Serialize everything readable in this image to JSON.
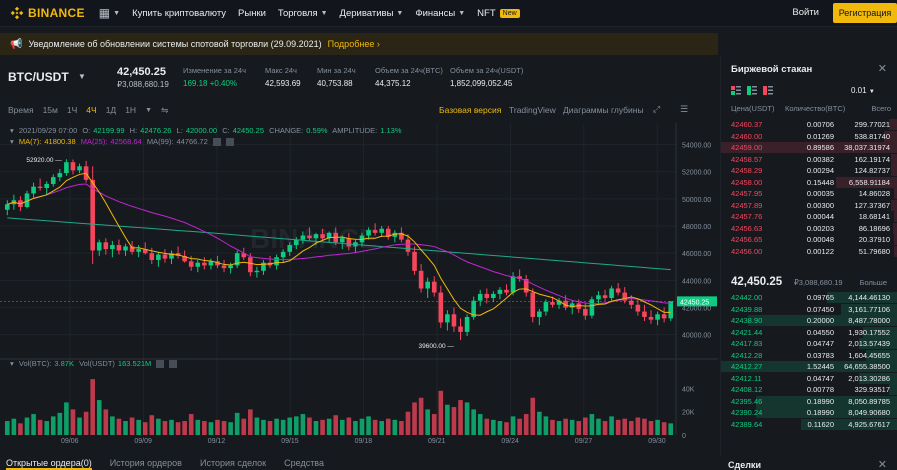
{
  "brand": {
    "name": "BINANCE",
    "color": "#f0b90b"
  },
  "nav": {
    "items": [
      {
        "label": "Купить криптовалюту",
        "dropdown": false
      },
      {
        "label": "Рынки",
        "dropdown": false
      },
      {
        "label": "Торговля",
        "dropdown": true
      },
      {
        "label": "Деривативы",
        "dropdown": true
      },
      {
        "label": "Финансы",
        "dropdown": true
      },
      {
        "label": "NFT",
        "dropdown": false,
        "badge": "New"
      }
    ],
    "login": "Войти",
    "register": "Регистрация"
  },
  "notice": {
    "text": "Уведомление об обновлении системы спотовой торговли (29.09.2021)",
    "more": "Подробнее"
  },
  "ticker": {
    "pair": "BTC/USDT",
    "last_price": "42,450.25",
    "last_price_usd": "₽3,088,680.19",
    "stats": [
      {
        "label": "Изменение за 24ч",
        "value": "169.18 +0.40%",
        "green": true
      },
      {
        "label": "Макс 24ч",
        "value": "42,593.69",
        "green": false
      },
      {
        "label": "Мин за 24ч",
        "value": "40,753.88",
        "green": false
      },
      {
        "label": "Объем за 24ч(BTC)",
        "value": "44,375.12",
        "green": false
      },
      {
        "label": "Объем за 24ч(USDT)",
        "value": "1,852,099,052.45",
        "green": false
      }
    ]
  },
  "toolbar": {
    "timeframes": [
      "Время",
      "15м",
      "1Ч",
      "4Ч",
      "1Д",
      "1Н"
    ],
    "active_timeframe": "4Ч",
    "views": [
      "Базовая версия",
      "TradingView",
      "Диаграммы глубины"
    ],
    "active_view": "Базовая версия"
  },
  "legend": {
    "ohlc": {
      "date": "2021/09/29 07:00",
      "o_label": "O:",
      "o": "42199.99",
      "h_label": "H:",
      "h": "42476.26",
      "l_label": "L:",
      "l": "42000.00",
      "c_label": "C:",
      "c": "42450.25",
      "change_label": "CHANGE:",
      "change": "0.59%",
      "amp_label": "AMPLITUDE:",
      "amp": "1.13%"
    },
    "ma": {
      "ma7_label": "MA(7):",
      "ma7": "41800.38",
      "ma25_label": "MA(25):",
      "ma25": "42568.64",
      "ma99_label": "MA(99):",
      "ma99": "44766.72"
    },
    "vol": {
      "btc_label": "Vol(BTC):",
      "btc": "3.87K",
      "usdt_label": "Vol(USDT)",
      "usdt": "163.521M"
    }
  },
  "colors": {
    "up": "#0ecb81",
    "down": "#f6465d",
    "ma7": "#f0b90b",
    "ma25": "#c026d3",
    "ma99": "#22a88a",
    "accent": "#f0b90b"
  },
  "chart_data": {
    "type": "candlestick",
    "x_ticks": [
      "09/06",
      "09/09",
      "09/12",
      "09/15",
      "09/18",
      "09/21",
      "09/24",
      "09/27",
      "09/30"
    ],
    "y_ticks": [
      "54000.00",
      "52000.00",
      "50000.00",
      "48000.00",
      "46000.00",
      "44000.00",
      "42000.00",
      "40000.00"
    ],
    "ylim": [
      38500,
      55000
    ],
    "vol_ticks": [
      "40K",
      "20K",
      "0"
    ],
    "annotations": {
      "high": "52920.00",
      "low": "39600.00"
    },
    "current_price": "42450.25",
    "candles": [
      [
        49200,
        49900,
        48800,
        49600
      ],
      [
        49600,
        50300,
        49200,
        49900
      ],
      [
        49900,
        50200,
        49100,
        49400
      ],
      [
        49400,
        50600,
        49300,
        50400
      ],
      [
        50400,
        51200,
        50100,
        50900
      ],
      [
        50900,
        51500,
        50600,
        50800
      ],
      [
        50800,
        51300,
        50300,
        51100
      ],
      [
        51100,
        51800,
        50900,
        51600
      ],
      [
        51600,
        52200,
        51300,
        51900
      ],
      [
        51900,
        52920,
        51700,
        52700
      ],
      [
        52700,
        52900,
        51800,
        52100
      ],
      [
        52100,
        52600,
        51900,
        52400
      ],
      [
        52400,
        52800,
        51200,
        51400
      ],
      [
        51400,
        52400,
        45200,
        46200
      ],
      [
        46200,
        47000,
        45800,
        46800
      ],
      [
        46800,
        47100,
        45900,
        46300
      ],
      [
        46300,
        46900,
        45700,
        46600
      ],
      [
        46600,
        47000,
        45900,
        46200
      ],
      [
        46200,
        46700,
        45800,
        46500
      ],
      [
        46500,
        46900,
        45900,
        46100
      ],
      [
        46100,
        46600,
        45700,
        46300
      ],
      [
        46300,
        46800,
        45900,
        46000
      ],
      [
        46000,
        46400,
        45200,
        45500
      ],
      [
        45500,
        46100,
        45000,
        45900
      ],
      [
        45900,
        46300,
        45300,
        45600
      ],
      [
        45600,
        46200,
        45200,
        46000
      ],
      [
        46000,
        46500,
        45600,
        45800
      ],
      [
        45800,
        46200,
        45300,
        45400
      ],
      [
        45400,
        45800,
        44700,
        45000
      ],
      [
        45000,
        45500,
        44600,
        45300
      ],
      [
        45300,
        45700,
        44800,
        45100
      ],
      [
        45100,
        45600,
        44800,
        45400
      ],
      [
        45400,
        45800,
        44900,
        45100
      ],
      [
        45100,
        45500,
        44600,
        44900
      ],
      [
        44900,
        45300,
        44500,
        45100
      ],
      [
        45100,
        46200,
        44900,
        46000
      ],
      [
        46000,
        46400,
        45500,
        45700
      ],
      [
        45700,
        46000,
        44300,
        44600
      ],
      [
        44600,
        45000,
        44200,
        44700
      ],
      [
        44700,
        45500,
        44400,
        45300
      ],
      [
        45300,
        45800,
        44900,
        45100
      ],
      [
        45100,
        45900,
        44800,
        45700
      ],
      [
        45700,
        46300,
        45300,
        46100
      ],
      [
        46100,
        46800,
        45800,
        46600
      ],
      [
        46600,
        47200,
        46300,
        47000
      ],
      [
        47000,
        47600,
        46700,
        47300
      ],
      [
        47300,
        47900,
        46900,
        47100
      ],
      [
        47100,
        47500,
        46600,
        47400
      ],
      [
        47400,
        47800,
        46900,
        47100
      ],
      [
        47100,
        47600,
        46800,
        47500
      ],
      [
        47500,
        47900,
        46600,
        46800
      ],
      [
        46800,
        47300,
        46300,
        47100
      ],
      [
        47100,
        47500,
        46200,
        46500
      ],
      [
        46500,
        47000,
        46000,
        46800
      ],
      [
        46800,
        47500,
        46500,
        47300
      ],
      [
        47300,
        47900,
        47000,
        47700
      ],
      [
        47700,
        48200,
        47300,
        47500
      ],
      [
        47500,
        48000,
        47200,
        47800
      ],
      [
        47800,
        48000,
        47000,
        47200
      ],
      [
        47200,
        47700,
        46800,
        47500
      ],
      [
        47500,
        47900,
        46800,
        47000
      ],
      [
        47000,
        47400,
        45800,
        46100
      ],
      [
        46100,
        46500,
        44400,
        44700
      ],
      [
        44700,
        45200,
        43100,
        43400
      ],
      [
        43400,
        44200,
        42700,
        43900
      ],
      [
        43900,
        44300,
        42800,
        43100
      ],
      [
        43100,
        43600,
        40500,
        40900
      ],
      [
        40900,
        41800,
        40300,
        41500
      ],
      [
        41500,
        42000,
        40200,
        40600
      ],
      [
        40600,
        41200,
        39600,
        40200
      ],
      [
        40200,
        41500,
        39900,
        41300
      ],
      [
        41300,
        42800,
        41100,
        42500
      ],
      [
        42500,
        43300,
        42100,
        43000
      ],
      [
        43000,
        43400,
        42300,
        42700
      ],
      [
        42700,
        43200,
        42400,
        43000
      ],
      [
        43000,
        43500,
        42600,
        43300
      ],
      [
        43300,
        43700,
        42900,
        43100
      ],
      [
        43100,
        44600,
        42900,
        44300
      ],
      [
        44300,
        44800,
        43900,
        44100
      ],
      [
        44100,
        44400,
        42800,
        43100
      ],
      [
        43100,
        43400,
        40900,
        41300
      ],
      [
        41300,
        41900,
        40700,
        41700
      ],
      [
        41700,
        42600,
        41400,
        42400
      ],
      [
        42400,
        42800,
        42000,
        42200
      ],
      [
        42200,
        42700,
        41900,
        42500
      ],
      [
        42500,
        42900,
        41800,
        42000
      ],
      [
        42000,
        42500,
        41500,
        42300
      ],
      [
        42300,
        42600,
        41600,
        41900
      ],
      [
        41900,
        42300,
        41100,
        41400
      ],
      [
        41400,
        42800,
        41200,
        42600
      ],
      [
        42600,
        43200,
        42300,
        42900
      ],
      [
        42900,
        43300,
        42500,
        42700
      ],
      [
        42700,
        43600,
        42500,
        43400
      ],
      [
        43400,
        43800,
        42900,
        43100
      ],
      [
        43100,
        43500,
        42300,
        42500
      ],
      [
        42500,
        42900,
        41900,
        42200
      ],
      [
        42200,
        42600,
        41400,
        41700
      ],
      [
        41700,
        42200,
        41000,
        41300
      ],
      [
        41300,
        41800,
        40800,
        41100
      ],
      [
        41100,
        41700,
        40700,
        41500
      ],
      [
        41500,
        42000,
        40900,
        41200
      ],
      [
        41200,
        42476,
        41000,
        42450
      ]
    ],
    "volumes": [
      12,
      14,
      10,
      15,
      18,
      13,
      12,
      16,
      19,
      28,
      22,
      15,
      20,
      48,
      30,
      22,
      16,
      14,
      12,
      15,
      13,
      11,
      17,
      14,
      12,
      13,
      11,
      12,
      18,
      13,
      12,
      11,
      13,
      12,
      11,
      19,
      14,
      22,
      15,
      13,
      12,
      14,
      13,
      15,
      16,
      18,
      15,
      12,
      13,
      14,
      17,
      13,
      15,
      12,
      14,
      16,
      13,
      12,
      14,
      13,
      12,
      20,
      28,
      32,
      22,
      18,
      38,
      26,
      24,
      30,
      28,
      22,
      18,
      14,
      13,
      12,
      11,
      16,
      14,
      18,
      32,
      20,
      16,
      13,
      12,
      14,
      13,
      12,
      15,
      18,
      14,
      12,
      16,
      13,
      14,
      12,
      15,
      14,
      12,
      13,
      11,
      10
    ]
  },
  "orderbook": {
    "title": "Биржевой стакан",
    "precision": "0.01",
    "headers": {
      "price": "Цена(USDT)",
      "qty": "Количество(BTC)",
      "total": "Всего"
    },
    "asks": [
      {
        "p": "42460.37",
        "q": "0.00706",
        "t": "299.77021",
        "d": 0.05
      },
      {
        "p": "42460.00",
        "q": "0.01269",
        "t": "538.81740",
        "d": 0.08
      },
      {
        "p": "42459.00",
        "q": "0.89586",
        "t": "38,037.31974",
        "d": 1.0
      },
      {
        "p": "42458.57",
        "q": "0.00382",
        "t": "162.19174",
        "d": 0.04
      },
      {
        "p": "42458.29",
        "q": "0.00294",
        "t": "124.82737",
        "d": 0.04
      },
      {
        "p": "42458.00",
        "q": "0.15448",
        "t": "6,558.91184",
        "d": 0.35
      },
      {
        "p": "42457.95",
        "q": "0.00035",
        "t": "14.86028",
        "d": 0.02
      },
      {
        "p": "42457.89",
        "q": "0.00300",
        "t": "127.37367",
        "d": 0.04
      },
      {
        "p": "42457.76",
        "q": "0.00044",
        "t": "18.68141",
        "d": 0.02
      },
      {
        "p": "42456.63",
        "q": "0.00203",
        "t": "86.18696",
        "d": 0.03
      },
      {
        "p": "42456.65",
        "q": "0.00048",
        "t": "20.37910",
        "d": 0.02
      },
      {
        "p": "42456.00",
        "q": "0.00122",
        "t": "51.79680",
        "d": 0.02
      }
    ],
    "mid": {
      "price": "42,450.25",
      "usd": "₽3,088,680.19",
      "more": "Больше"
    },
    "bids": [
      {
        "p": "42442.00",
        "q": "0.09765",
        "t": "4,144.46130",
        "d": 0.4
      },
      {
        "p": "42439.88",
        "q": "0.07450",
        "t": "3,161.77106",
        "d": 0.32
      },
      {
        "p": "42438.90",
        "q": "0.20000",
        "t": "8,487.78000",
        "d": 0.85
      },
      {
        "p": "42421.44",
        "q": "0.04550",
        "t": "1,930.17552",
        "d": 0.2
      },
      {
        "p": "42417.83",
        "q": "0.04747",
        "t": "2,013.57439",
        "d": 0.22
      },
      {
        "p": "42412.28",
        "q": "0.03783",
        "t": "1,604.45655",
        "d": 0.18
      },
      {
        "p": "42412.27",
        "q": "1.52445",
        "t": "64,655.38500",
        "d": 1.0
      },
      {
        "p": "42412.11",
        "q": "0.04747",
        "t": "2,013.30286",
        "d": 0.22
      },
      {
        "p": "42408.12",
        "q": "0.00778",
        "t": "329.93517",
        "d": 0.05
      },
      {
        "p": "42395.46",
        "q": "0.18990",
        "t": "8,050.89785",
        "d": 0.8
      },
      {
        "p": "42390.24",
        "q": "0.18990",
        "t": "8,049.90680",
        "d": 0.8
      },
      {
        "p": "42389.64",
        "q": "0.11620",
        "t": "4,925.67617",
        "d": 0.55
      }
    ]
  },
  "bottom_tabs": [
    {
      "label": "Открытые ордера(0)",
      "active": true
    },
    {
      "label": "История ордеров",
      "active": false
    },
    {
      "label": "История сделок",
      "active": false
    },
    {
      "label": "Средства",
      "active": false
    }
  ],
  "trades": {
    "title": "Сделки"
  }
}
